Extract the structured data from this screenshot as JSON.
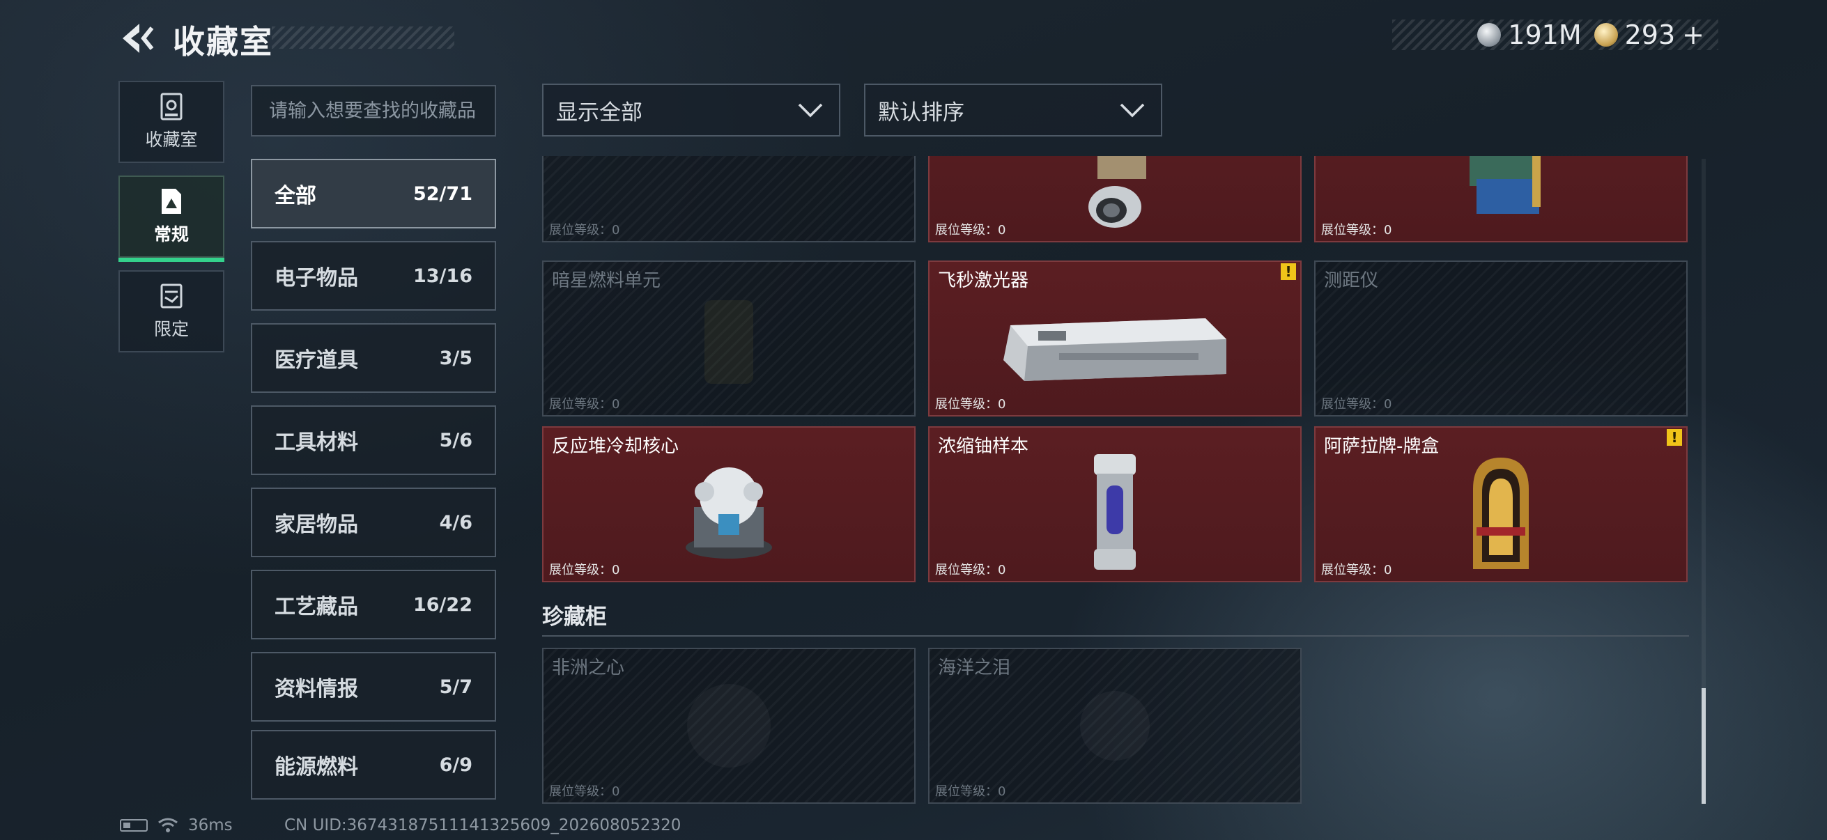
{
  "header": {
    "title": "收藏室",
    "currencies": [
      {
        "icon": "silver-coin-icon",
        "value": "191M"
      },
      {
        "icon": "gold-coin-icon",
        "value": "293"
      }
    ],
    "add_symbol": "+"
  },
  "nav": [
    {
      "label": "收藏室",
      "icon": "collection-room-icon"
    },
    {
      "label": "常规",
      "icon": "regular-icon",
      "active": true
    },
    {
      "label": "限定",
      "icon": "limited-icon"
    }
  ],
  "search": {
    "placeholder": "请输入想要查找的收藏品"
  },
  "filters": {
    "show": "显示全部",
    "sort": "默认排序"
  },
  "categories": [
    {
      "label": "全部",
      "count": "52/71",
      "active": true
    },
    {
      "label": "电子物品",
      "count": "13/16"
    },
    {
      "label": "医疗道具",
      "count": "3/5"
    },
    {
      "label": "工具材料",
      "count": "5/6"
    },
    {
      "label": "家居物品",
      "count": "4/6"
    },
    {
      "label": "工艺藏品",
      "count": "16/22"
    },
    {
      "label": "资料情报",
      "count": "5/7"
    },
    {
      "label": "能源燃料",
      "count": "6/9"
    }
  ],
  "level_label": "展位等级：0",
  "items": [
    {
      "name": "",
      "owned": false
    },
    {
      "name": "",
      "owned": true
    },
    {
      "name": "",
      "owned": true
    },
    {
      "name": "暗星燃料单元",
      "owned": false
    },
    {
      "name": "飞秒激光器",
      "owned": true,
      "alert": "!"
    },
    {
      "name": "测距仪",
      "owned": false
    },
    {
      "name": "反应堆冷却核心",
      "owned": true
    },
    {
      "name": "浓缩铀样本",
      "owned": true
    },
    {
      "name": "阿萨拉牌-牌盒",
      "owned": true,
      "alert": "!"
    }
  ],
  "section": {
    "label": "珍藏柜"
  },
  "cabinet_items": [
    {
      "name": "非洲之心",
      "owned": false
    },
    {
      "name": "海洋之泪",
      "owned": false
    }
  ],
  "status": {
    "ping": "36ms",
    "uid": "CN UID:36743187511141325609_202608052320"
  },
  "colors": {
    "owned_bg": "#5b1e22",
    "accent": "#34d28c",
    "alert": "#f0c419"
  }
}
